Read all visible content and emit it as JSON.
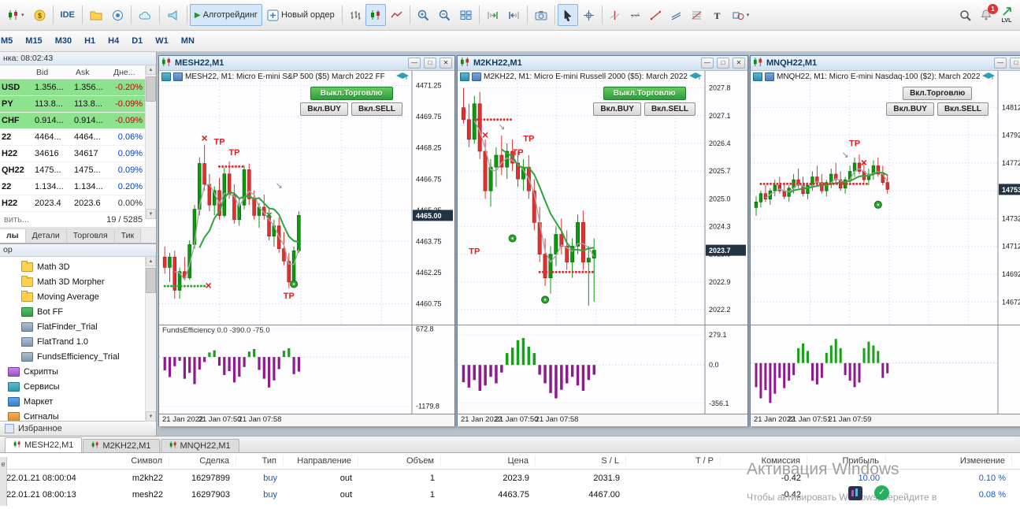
{
  "toolbar": {
    "ide": "IDE",
    "algo": "Алготрейдинг",
    "new_order": "Новый ордер",
    "badge": "1",
    "lvl": "LVL"
  },
  "timeframes": [
    "M5",
    "M15",
    "M30",
    "H1",
    "H4",
    "D1",
    "W1",
    "MN"
  ],
  "market_watch": {
    "title": "нка: 08:02:43",
    "columns": [
      "",
      "Bid",
      "Ask",
      "Дне..."
    ],
    "rows": [
      {
        "symbol": "USD",
        "bid": "1.356...",
        "ask": "1.356...",
        "change": "-0.20%",
        "highlight": true
      },
      {
        "symbol": "PY",
        "bid": "113.8...",
        "ask": "113.8...",
        "change": "-0.09%",
        "highlight": true
      },
      {
        "symbol": "CHF",
        "bid": "0.914...",
        "ask": "0.914...",
        "change": "-0.09%",
        "highlight": true
      },
      {
        "symbol": "22",
        "bid": "4464...",
        "ask": "4464...",
        "change": "0.06%",
        "highlight": false
      },
      {
        "symbol": "H22",
        "bid": "34616",
        "ask": "34617",
        "change": "0.09%",
        "highlight": false
      },
      {
        "symbol": "QH22",
        "bid": "1475...",
        "ask": "1475...",
        "change": "0.09%",
        "highlight": false
      },
      {
        "symbol": "22",
        "bid": "1.134...",
        "ask": "1.134...",
        "change": "0.20%",
        "highlight": false
      },
      {
        "symbol": "H22",
        "bid": "2023.4",
        "ask": "2023.6",
        "change": "0.00%",
        "highlight": false
      }
    ],
    "add_label": "вить...",
    "counter": "19 / 5285",
    "tabs": [
      "лы",
      "Детали",
      "Торговля",
      "Тик"
    ]
  },
  "navigator": {
    "title": "ор",
    "items": [
      {
        "label": "Math 3D",
        "icon": "folder",
        "root": false
      },
      {
        "label": "Math 3D Morpher",
        "icon": "folder",
        "root": false
      },
      {
        "label": "Moving Average",
        "icon": "folder",
        "root": false
      },
      {
        "label": "Bot FF",
        "icon": "bot",
        "root": false
      },
      {
        "label": "FlatFinder_Trial",
        "icon": "ea",
        "root": false
      },
      {
        "label": "FlatTrand 1.0",
        "icon": "ea",
        "root": false
      },
      {
        "label": "FundsEfficiency_Trial",
        "icon": "ea",
        "root": false
      },
      {
        "label": "Скрипты",
        "icon": "scripts",
        "root": true
      },
      {
        "label": "Сервисы",
        "icon": "services",
        "root": true
      },
      {
        "label": "Маркет",
        "icon": "market",
        "root": true
      },
      {
        "label": "Сигналы",
        "icon": "signals",
        "root": true
      }
    ],
    "favorites_label": "Избранное"
  },
  "charts": [
    {
      "window_title": "MESH22,M1",
      "chart_title": "MESH22, M1:  Micro E-mini S&P 500 ($5) March 2022 FF",
      "trade_btn": "Выкл.Торговлю",
      "trade_on": true,
      "buy_btn": "Вкл.BUY",
      "sell_btn": "Вкл.SELL",
      "type": "candlestick",
      "ylim": [
        4459.9,
        4471.8
      ],
      "decimals": 2,
      "yticks": [
        4471.25,
        4469.75,
        4468.25,
        4466.75,
        4465.25,
        4463.75,
        4462.25,
        4460.75
      ],
      "current": "4465.00",
      "current_val": 4465.0,
      "times": [
        "21 Jan 2022",
        "21 Jan 07:50",
        "21 Jan 07:58"
      ],
      "indicator_label": "FundsEfficiency 0.0 -390.0 -75.0",
      "candles": [
        [
          4463.0,
          4463.5,
          4462.2,
          4462.5
        ],
        [
          4462.5,
          4463.2,
          4461.8,
          4463.0
        ],
        [
          4463.0,
          4463.3,
          4461.0,
          4461.4
        ],
        [
          4461.4,
          4462.5,
          4461.0,
          4462.3
        ],
        [
          4462.3,
          4463.0,
          4461.9,
          4462.0
        ],
        [
          4462.0,
          4463.8,
          4461.9,
          4463.6
        ],
        [
          4463.6,
          4465.5,
          4463.4,
          4465.3
        ],
        [
          4465.3,
          4467.8,
          4465.0,
          4467.5
        ],
        [
          4467.5,
          4468.4,
          4466.2,
          4466.5
        ],
        [
          4466.5,
          4467.0,
          4465.2,
          4465.5
        ],
        [
          4465.5,
          4466.4,
          4465.0,
          4466.2
        ],
        [
          4466.2,
          4466.8,
          4464.8,
          4465.0
        ],
        [
          4465.0,
          4467.3,
          4464.9,
          4467.0
        ],
        [
          4467.0,
          4467.6,
          4465.8,
          4466.0
        ],
        [
          4466.0,
          4466.5,
          4464.6,
          4464.8
        ],
        [
          4464.8,
          4465.8,
          4464.5,
          4465.5
        ],
        [
          4465.5,
          4467.4,
          4465.3,
          4467.2
        ],
        [
          4467.2,
          4467.5,
          4465.5,
          4465.8
        ],
        [
          4465.8,
          4466.2,
          4464.8,
          4465.0
        ],
        [
          4465.0,
          4465.6,
          4464.4,
          4465.4
        ],
        [
          4465.4,
          4466.0,
          4464.8,
          4465.0
        ],
        [
          4465.0,
          4465.4,
          4463.8,
          4464.0
        ],
        [
          4464.0,
          4464.8,
          4463.5,
          4464.5
        ],
        [
          4464.5,
          4464.9,
          4463.2,
          4463.4
        ],
        [
          4463.4,
          4464.2,
          4462.6,
          4462.8
        ],
        [
          4462.8,
          4463.2,
          4461.5,
          4461.8
        ],
        [
          4461.8,
          4463.5,
          4461.6,
          4463.3
        ],
        [
          4463.3,
          4465.2,
          4463.2,
          4465.0
        ]
      ],
      "dots": [
        {
          "i0": 0,
          "i1": 8,
          "p": 4461.6,
          "c": "#2aa52a"
        },
        {
          "i0": 11,
          "i1": 16,
          "p": 4467.35,
          "c": "#d23030"
        }
      ],
      "markers": [
        {
          "t": "x",
          "i": 8.8,
          "p": 4461.6
        },
        {
          "t": "x",
          "i": 8,
          "p": 4468.7
        },
        {
          "t": "tp",
          "i": 11,
          "p": 4468.4
        },
        {
          "t": "tp",
          "i": 14,
          "p": 4467.9
        },
        {
          "t": "gx",
          "i": 21,
          "p": 4465.0
        },
        {
          "t": "tp",
          "i": 25,
          "p": 4461.0
        },
        {
          "t": "buy",
          "i": 26,
          "p": 4461.7
        },
        {
          "t": "arr",
          "i": 23,
          "p": 4466.3
        }
      ],
      "hist": [
        -320,
        -480,
        -220,
        -90,
        -520,
        -380,
        -650,
        -300,
        -120,
        110,
        160,
        -210,
        -430,
        -340,
        -610,
        -470,
        -240,
        130,
        190,
        -310,
        -520,
        -730,
        -560,
        -290,
        150,
        210,
        -410,
        -350
      ],
      "hist_ylim": [
        -1300,
        700
      ],
      "hist_ticks": [
        {
          "v": 672.8,
          "label": "672.8"
        },
        {
          "v": -1179.8,
          "label": "-1179.8"
        }
      ]
    },
    {
      "window_title": "M2KH22,M1",
      "chart_title": "M2KH22, M1:  Micro E-mini Russell 2000 ($5): March 2022",
      "trade_btn": "Выкл.Торговлю",
      "trade_on": true,
      "buy_btn": "Вкл.BUY",
      "sell_btn": "Вкл.SELL",
      "type": "candlestick",
      "ylim": [
        2021.9,
        2028.15
      ],
      "decimals": 1,
      "yticks": [
        2027.8,
        2027.1,
        2026.4,
        2025.7,
        2025.0,
        2024.3,
        2023.6,
        2022.9,
        2022.2
      ],
      "current": "2023.7",
      "current_val": 2023.7,
      "times": [
        "21 Jan 2022",
        "21 Jan 07:50",
        "21 Jan 07:58"
      ],
      "indicator_label": "",
      "candles": [
        [
          2027.3,
          2027.8,
          2026.9,
          2027.0
        ],
        [
          2027.0,
          2027.4,
          2026.3,
          2026.5
        ],
        [
          2026.5,
          2027.6,
          2026.4,
          2027.4
        ],
        [
          2027.4,
          2027.7,
          2026.0,
          2026.2
        ],
        [
          2026.2,
          2026.5,
          2025.0,
          2025.2
        ],
        [
          2025.2,
          2026.0,
          2024.8,
          2025.8
        ],
        [
          2025.8,
          2026.3,
          2025.3,
          2026.1
        ],
        [
          2026.1,
          2026.6,
          2025.6,
          2025.8
        ],
        [
          2025.8,
          2026.4,
          2025.5,
          2026.2
        ],
        [
          2026.2,
          2026.5,
          2025.7,
          2025.9
        ],
        [
          2025.9,
          2026.2,
          2025.3,
          2025.5
        ],
        [
          2025.5,
          2026.0,
          2025.2,
          2025.8
        ],
        [
          2025.8,
          2026.1,
          2025.0,
          2025.2
        ],
        [
          2025.2,
          2025.5,
          2024.2,
          2024.4
        ],
        [
          2024.4,
          2024.8,
          2023.4,
          2023.6
        ],
        [
          2023.6,
          2024.0,
          2022.8,
          2023.0
        ],
        [
          2023.0,
          2023.8,
          2022.6,
          2023.6
        ],
        [
          2023.6,
          2024.3,
          2023.3,
          2024.1
        ],
        [
          2024.1,
          2024.5,
          2023.6,
          2023.8
        ],
        [
          2023.8,
          2024.2,
          2023.2,
          2023.4
        ],
        [
          2023.4,
          2024.0,
          2023.0,
          2023.8
        ],
        [
          2023.8,
          2024.6,
          2023.6,
          2024.4
        ],
        [
          2024.4,
          2024.7,
          2023.2,
          2023.4
        ],
        [
          2023.4,
          2023.8,
          2022.3,
          2023.5
        ],
        [
          2023.5,
          2024.0,
          2022.4,
          2023.7
        ]
      ],
      "dots": [
        {
          "i0": 2,
          "i1": 9,
          "p": 2027.0,
          "c": "#d23030"
        },
        {
          "i0": 14,
          "i1": 24,
          "p": 2023.15,
          "c": "#d23030"
        }
      ],
      "markers": [
        {
          "t": "x",
          "i": 4,
          "p": 2026.6
        },
        {
          "t": "tp",
          "i": 2,
          "p": 2023.6
        },
        {
          "t": "tp",
          "i": 10,
          "p": 2026.1
        },
        {
          "t": "tp",
          "i": 12,
          "p": 2026.45
        },
        {
          "t": "buy",
          "i": 9,
          "p": 2024.0
        },
        {
          "t": "buy",
          "i": 15,
          "p": 2022.45
        },
        {
          "t": "arr",
          "i": 7,
          "p": 2026.75
        }
      ],
      "hist": [
        -160,
        -210,
        -140,
        -240,
        -190,
        -110,
        -170,
        -70,
        110,
        160,
        230,
        250,
        170,
        110,
        -90,
        -170,
        -260,
        -310,
        -230,
        -170,
        -110,
        -190,
        -240,
        -140,
        -90
      ],
      "hist_ylim": [
        -430,
        345
      ],
      "hist_ticks": [
        {
          "v": 279.1,
          "label": "279.1"
        },
        {
          "v": 0,
          "label": "0.0"
        },
        {
          "v": -356.1,
          "label": "-356.1"
        }
      ]
    },
    {
      "window_title": "MNQH22,M1",
      "chart_title": "MNQH22, M1:  Micro E-mini Nasdaq-100 ($2): March 2022",
      "trade_btn": "Вкл.Торговлю",
      "trade_on": false,
      "buy_btn": "Вкл.BUY",
      "sell_btn": "Вкл.SELL",
      "type": "candlestick",
      "ylim": [
        14658,
        14836
      ],
      "decimals": 0,
      "yticks": [
        14812,
        14792,
        14772,
        14752,
        14732,
        14712,
        14692,
        14672
      ],
      "current": "14753",
      "current_val": 14753,
      "times": [
        "21 Jan 2022",
        "21 Jan 07:51",
        "21 Jan 07:59"
      ],
      "indicator_label": "",
      "candles": [
        [
          14740,
          14748,
          14734,
          14744
        ],
        [
          14744,
          14752,
          14740,
          14750
        ],
        [
          14750,
          14756,
          14744,
          14746
        ],
        [
          14746,
          14754,
          14742,
          14752
        ],
        [
          14752,
          14760,
          14748,
          14756
        ],
        [
          14756,
          14762,
          14750,
          14752
        ],
        [
          14752,
          14758,
          14746,
          14748
        ],
        [
          14748,
          14756,
          14744,
          14754
        ],
        [
          14754,
          14764,
          14750,
          14760
        ],
        [
          14760,
          14768,
          14754,
          14756
        ],
        [
          14756,
          14762,
          14748,
          14750
        ],
        [
          14750,
          14758,
          14746,
          14756
        ],
        [
          14756,
          14766,
          14752,
          14762
        ],
        [
          14762,
          14770,
          14756,
          14758
        ],
        [
          14758,
          14764,
          14750,
          14752
        ],
        [
          14752,
          14760,
          14748,
          14758
        ],
        [
          14758,
          14768,
          14754,
          14764
        ],
        [
          14764,
          14772,
          14758,
          14760
        ],
        [
          14760,
          14766,
          14752,
          14754
        ],
        [
          14754,
          14762,
          14750,
          14760
        ],
        [
          14760,
          14770,
          14756,
          14766
        ],
        [
          14766,
          14776,
          14762,
          14772
        ],
        [
          14772,
          14778,
          14764,
          14766
        ],
        [
          14766,
          14772,
          14758,
          14760
        ],
        [
          14760,
          14768,
          14756,
          14764
        ],
        [
          14764,
          14774,
          14760,
          14770
        ],
        [
          14770,
          14776,
          14762,
          14764
        ],
        [
          14764,
          14770,
          14756,
          14758
        ],
        [
          14758,
          14764,
          14750,
          14753
        ]
      ],
      "dots": [
        {
          "i0": 1,
          "i1": 24,
          "p": 14757,
          "c": "#d23030"
        }
      ],
      "markers": [
        {
          "t": "tp",
          "i": 21,
          "p": 14784
        },
        {
          "t": "x",
          "i": 23,
          "p": 14772
        },
        {
          "t": "arr",
          "i": 19,
          "p": 14776
        },
        {
          "t": "buy",
          "i": 26,
          "p": 14742
        }
      ],
      "hist": [
        -260,
        -380,
        -290,
        -430,
        -330,
        -160,
        -270,
        -190,
        -130,
        160,
        210,
        130,
        -190,
        -230,
        -160,
        110,
        190,
        260,
        160,
        -130,
        -190,
        -260,
        -210,
        160,
        230,
        190,
        130,
        -160,
        -110
      ],
      "hist_ylim": [
        -520,
        380
      ],
      "hist_ticks": []
    }
  ],
  "chart_tabs": [
    {
      "label": "MESH22,M1",
      "active": true
    },
    {
      "label": "M2KH22,M1",
      "active": false
    },
    {
      "label": "MNQH22,M1",
      "active": false
    }
  ],
  "trades": {
    "columns": [
      {
        "label": "",
        "w": 120
      },
      {
        "label": "Символ",
        "w": 95
      },
      {
        "label": "Сделка",
        "w": 85
      },
      {
        "label": "Тип",
        "w": 60
      },
      {
        "label": "Направление",
        "w": 95
      },
      {
        "label": "Объем",
        "w": 105
      },
      {
        "label": "Цена",
        "w": 120
      },
      {
        "label": "S / L",
        "w": 115
      },
      {
        "label": "T / P",
        "w": 120
      },
      {
        "label": "Комиссия",
        "w": 110
      },
      {
        "label": "Прибыль",
        "w": 100
      },
      {
        "label": "Изменение",
        "w": 160
      }
    ],
    "rows": [
      [
        "22.01.21 08:00:04",
        "m2kh22",
        "16297899",
        "buy",
        "out",
        "1",
        "2023.9",
        "2031.9",
        "",
        "-0.42",
        "10.00",
        "0.10 %"
      ],
      [
        "22.01.21 08:00:13",
        "mesh22",
        "16297903",
        "buy",
        "out",
        "1",
        "4463.75",
        "4467.00",
        "",
        "-0.42",
        "",
        "0.08 %"
      ]
    ]
  },
  "watermark": {
    "line1": "Активация Windows",
    "line2": "Чтобы активировать Windows, перейдите в "
  },
  "clipped": {
    "tab": "е"
  }
}
